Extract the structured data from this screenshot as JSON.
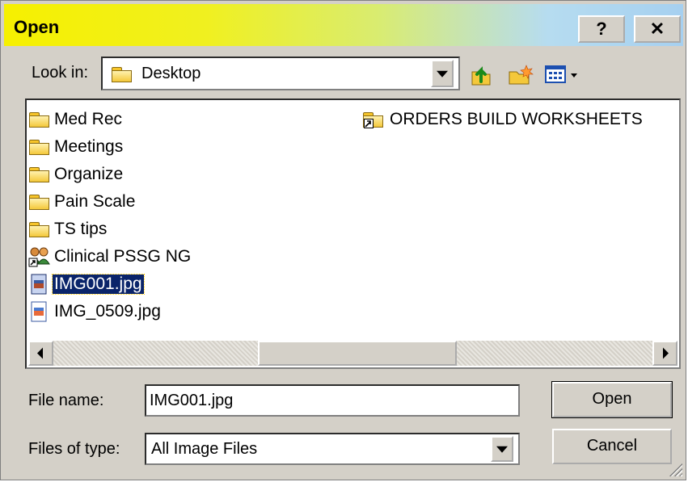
{
  "dialog": {
    "title": "Open",
    "help_label": "?",
    "close_label": "✕"
  },
  "look_in": {
    "label": "Look in:",
    "value": "Desktop"
  },
  "toolbar": {
    "icons": [
      "up-one-level-icon",
      "create-new-folder-icon",
      "view-menu-icon"
    ]
  },
  "files": [
    {
      "name": "Med Rec",
      "type": "folder",
      "selected": false
    },
    {
      "name": "Meetings",
      "type": "folder",
      "selected": false
    },
    {
      "name": "Organize",
      "type": "folder",
      "selected": false
    },
    {
      "name": "Pain Scale",
      "type": "folder",
      "selected": false
    },
    {
      "name": "TS tips",
      "type": "folder",
      "selected": false
    },
    {
      "name": "Clinical PSSG NG",
      "type": "shortcut-group",
      "selected": false
    },
    {
      "name": "IMG001.jpg",
      "type": "image",
      "selected": true
    },
    {
      "name": "IMG_0509.jpg",
      "type": "image",
      "selected": false
    },
    {
      "name": "ORDERS BUILD WORKSHEETS",
      "type": "folder-shortcut",
      "selected": false
    }
  ],
  "file_name": {
    "label": "File name:",
    "value": "IMG001.jpg"
  },
  "file_type": {
    "label": "Files of type:",
    "value": "All Image Files"
  },
  "buttons": {
    "open": "Open",
    "cancel": "Cancel"
  },
  "colors": {
    "title_gradient_start": "#f6f000",
    "title_gradient_end": "#a6d0f0",
    "selection": "#0a246a",
    "face": "#d4d0c8"
  }
}
